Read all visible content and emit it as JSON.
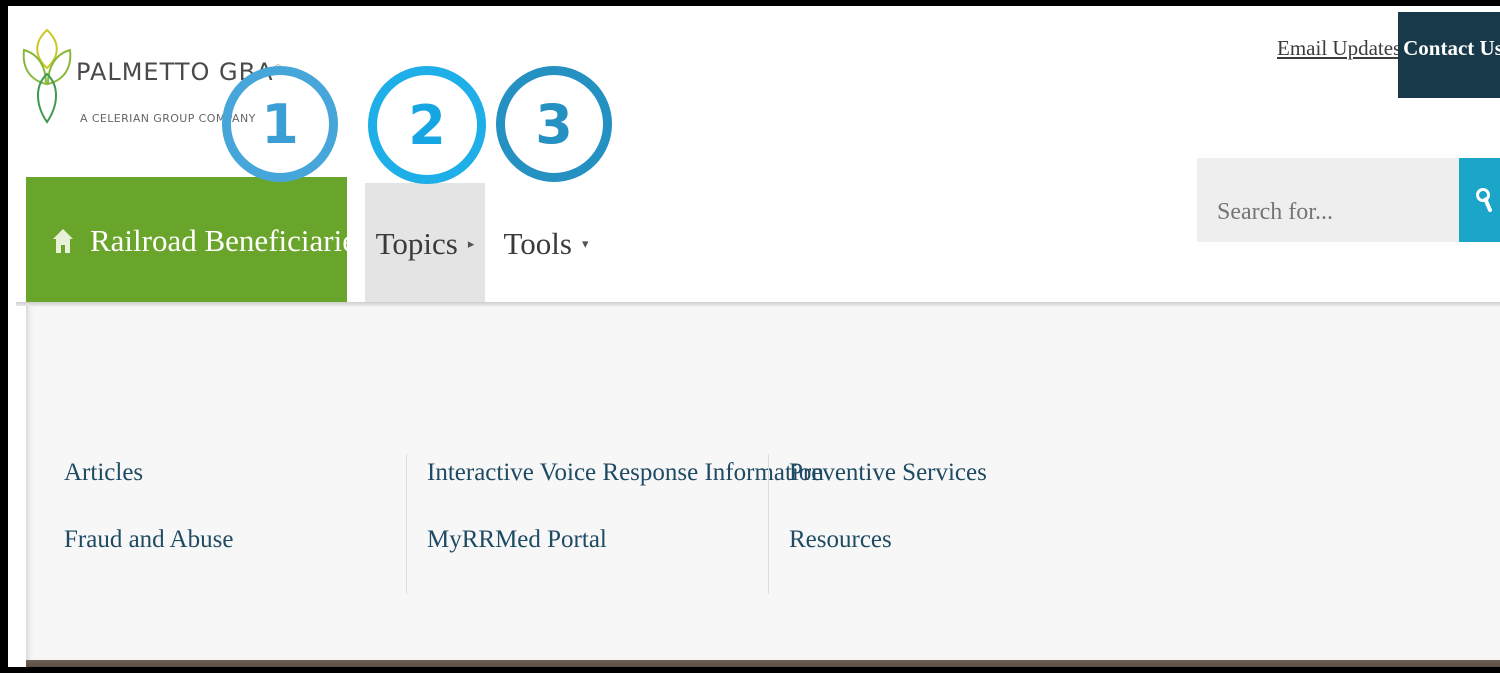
{
  "logo": {
    "name": "PALMETTO GBA",
    "registered": "®",
    "tagline": "A CELERIAN GROUP COMPANY"
  },
  "callouts": [
    "1",
    "2",
    "3"
  ],
  "top_links": {
    "email_updates": "Email Updates",
    "contact_us": "Contact Us"
  },
  "search": {
    "placeholder": "Search for...",
    "icon": "search-icon"
  },
  "nav": {
    "home": {
      "label": "Railroad Beneficiaries",
      "icon": "home-icon"
    },
    "topics": {
      "label": "Topics"
    },
    "tools": {
      "label": "Tools"
    }
  },
  "dropdown": {
    "columns": [
      [
        "Articles",
        "Fraud and Abuse"
      ],
      [
        "Interactive Voice Response Information",
        "MyRRMed Portal"
      ],
      [
        "Preventive Services",
        "Resources"
      ]
    ]
  },
  "colors": {
    "brand_green": "#6aa52b",
    "contact_bg": "#17394a",
    "search_button": "#1aa5c9",
    "link": "#1f4a63",
    "callout_blue": "#1eaee8"
  }
}
